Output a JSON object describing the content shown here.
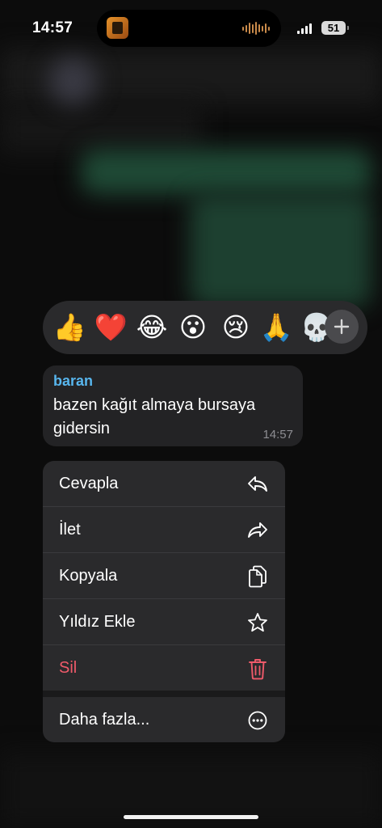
{
  "status_bar": {
    "time": "14:57",
    "battery": "51"
  },
  "reactions": {
    "emojis": [
      "👍",
      "❤️",
      "😂",
      "😮",
      "😢",
      "🙏",
      "💀"
    ],
    "more_icon": "plus-icon"
  },
  "message": {
    "sender": "baran",
    "text": "bazen kağıt almaya bursaya gidersin",
    "time": "14:57",
    "sender_color": "#58b6ee"
  },
  "menu": {
    "items": [
      {
        "label": "Cevapla",
        "icon": "reply-icon"
      },
      {
        "label": "İlet",
        "icon": "forward-icon"
      },
      {
        "label": "Kopyala",
        "icon": "copy-icon"
      },
      {
        "label": "Yıldız Ekle",
        "icon": "star-icon"
      },
      {
        "label": "Sil",
        "icon": "trash-icon",
        "color": "#ef5a6a"
      },
      {
        "label": "Daha fazla...",
        "icon": "more-icon"
      }
    ]
  }
}
